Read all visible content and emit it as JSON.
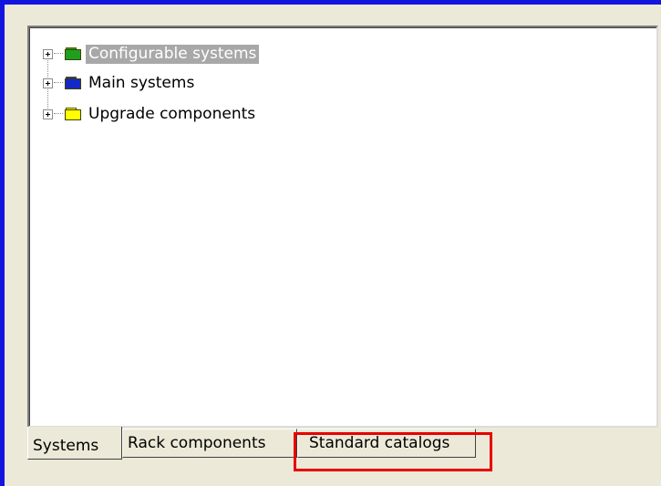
{
  "tree": {
    "items": [
      {
        "label": "Configurable systems",
        "icon": "green-folder-icon",
        "folder_color": "#1ea01e",
        "selected": true
      },
      {
        "label": "Main systems",
        "icon": "blue-folder-icon",
        "folder_color": "#1428c8",
        "selected": false
      },
      {
        "label": "Upgrade components",
        "icon": "yellow-folder-icon",
        "folder_color": "#ffff00",
        "selected": false
      }
    ]
  },
  "tabs": [
    {
      "label": "Systems",
      "active": true
    },
    {
      "label": "Rack components",
      "active": false
    },
    {
      "label": "Standard catalogs",
      "active": false
    }
  ],
  "colors": {
    "frame": "#1414e0",
    "highlight": "#e60000",
    "selection": "#a8a8a8"
  }
}
